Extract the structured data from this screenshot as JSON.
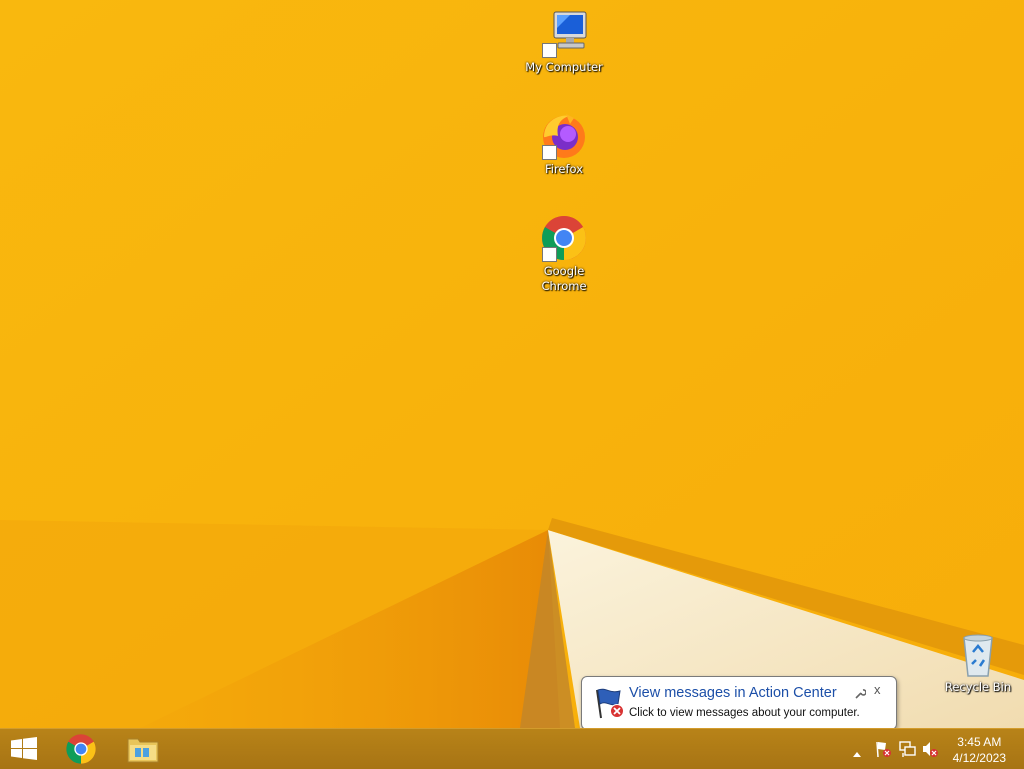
{
  "desktop": {
    "icons": [
      {
        "label": "My Computer",
        "icon": "computer-icon"
      },
      {
        "label": "Firefox",
        "icon": "firefox-icon"
      },
      {
        "label": "Google Chrome",
        "icon": "chrome-icon"
      },
      {
        "label": "Recycle Bin",
        "icon": "recycle-bin-icon"
      }
    ]
  },
  "taskbar": {
    "pinned": [
      {
        "name": "start",
        "icon": "windows-logo-icon"
      },
      {
        "name": "chrome",
        "icon": "chrome-icon"
      },
      {
        "name": "file-explorer",
        "icon": "folder-icon"
      }
    ],
    "tray": {
      "icons": [
        "show-hidden-icons-chevron",
        "action-center-flag-icon",
        "network-icon",
        "volume-muted-icon"
      ],
      "time": "3:45 AM",
      "date": "4/12/2023"
    }
  },
  "balloon": {
    "title": "View messages in Action Center",
    "body": "Click to view messages about your computer.",
    "close_symbol": "x"
  },
  "colors": {
    "wallpaper": "#f8b70c",
    "taskbar": "#b07a16",
    "balloon_title": "#1c4fa8"
  }
}
